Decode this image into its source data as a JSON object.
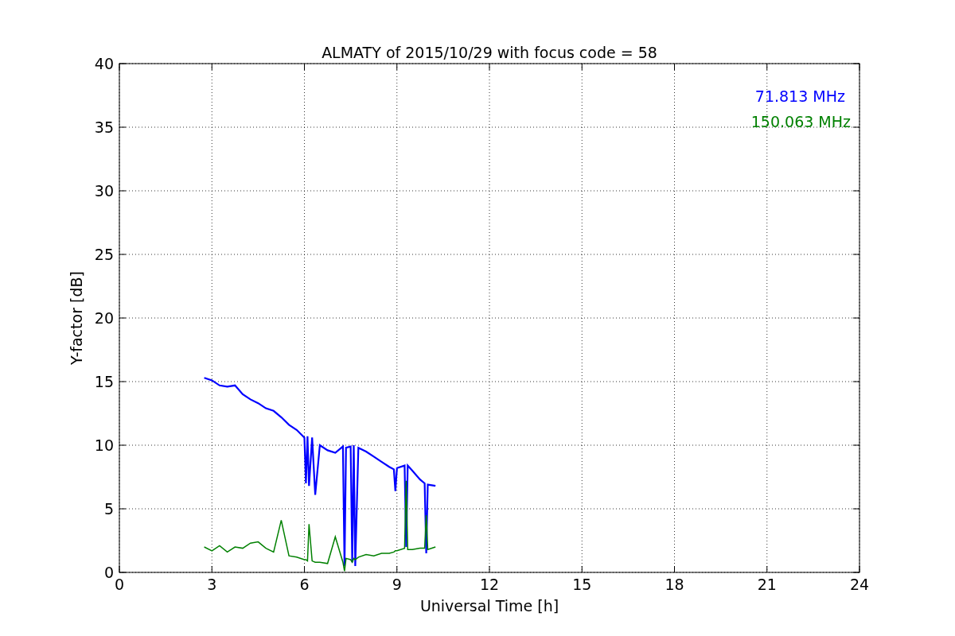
{
  "figure": {
    "chart_data": {
      "type": "line",
      "title": "ALMATY of 2015/10/29 with focus code = 58",
      "xlabel": "Universal Time [h]",
      "ylabel": "Y-factor [dB]",
      "x": [
        2.75,
        3,
        3.25,
        3.5,
        3.75,
        4,
        4.25,
        4.5,
        4.75,
        5,
        5.25,
        5.5,
        5.75,
        6,
        6.05,
        6.1,
        6.15,
        6.25,
        6.35,
        6.5,
        6.75,
        7,
        7.25,
        7.3,
        7.35,
        7.5,
        7.55,
        7.6,
        7.65,
        7.75,
        8,
        8.25,
        8.5,
        8.75,
        8.9,
        8.95,
        9,
        9.25,
        9.3,
        9.35,
        9.5,
        9.75,
        9.9,
        9.95,
        10,
        10.25
      ],
      "series": [
        {
          "name": "71.813 MHz",
          "color": "#0000ff",
          "values": [
            15.3,
            15.1,
            14.7,
            14.6,
            14.7,
            14.0,
            13.6,
            13.3,
            12.9,
            12.7,
            12.2,
            11.6,
            11.2,
            10.6,
            7.0,
            10.7,
            6.8,
            10.6,
            6.1,
            10.0,
            9.6,
            9.4,
            9.9,
            0.5,
            9.8,
            9.9,
            0.8,
            10.0,
            0.5,
            9.8,
            9.5,
            9.1,
            8.7,
            8.3,
            8.1,
            6.4,
            8.2,
            8.4,
            2.0,
            8.4,
            8.0,
            7.3,
            7.0,
            1.5,
            6.9,
            6.8
          ]
        },
        {
          "name": "150.063 MHz",
          "color": "#008000",
          "values": [
            2.0,
            1.7,
            2.1,
            1.6,
            2.0,
            1.9,
            2.3,
            2.4,
            1.9,
            1.6,
            4.1,
            1.3,
            1.2,
            1.0,
            1.0,
            0.9,
            3.8,
            0.9,
            0.8,
            0.8,
            0.7,
            2.8,
            0.8,
            0.1,
            1.1,
            1.0,
            0.8,
            1.1,
            1.0,
            1.2,
            1.4,
            1.3,
            1.5,
            1.5,
            1.6,
            1.7,
            1.7,
            1.9,
            7.2,
            1.8,
            1.8,
            1.9,
            1.9,
            4.5,
            1.8,
            2.0
          ]
        }
      ],
      "grid": true,
      "xlim": [
        0,
        24
      ],
      "ylim": [
        0,
        40
      ],
      "xticks": [
        0,
        3,
        6,
        9,
        12,
        15,
        18,
        21,
        24
      ],
      "yticks": [
        0,
        5,
        10,
        15,
        20,
        25,
        30,
        35,
        40
      ]
    }
  }
}
